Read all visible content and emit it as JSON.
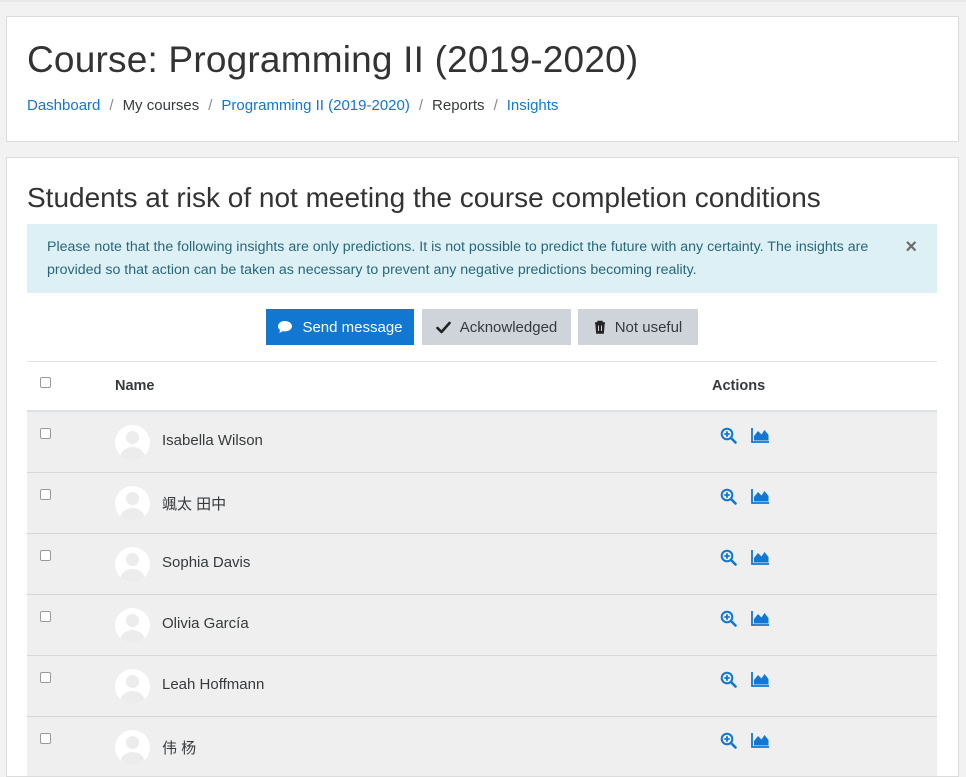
{
  "header": {
    "title": "Course: Programming II (2019-2020)",
    "breadcrumb": [
      {
        "label": "Dashboard",
        "link": true
      },
      {
        "label": "My courses",
        "link": false
      },
      {
        "label": "Programming II (2019-2020)",
        "link": true
      },
      {
        "label": "Reports",
        "link": false
      },
      {
        "label": "Insights",
        "link": true
      }
    ]
  },
  "main": {
    "title": "Students at risk of not meeting the course completion conditions",
    "alert": {
      "text": "Please note that the following insights are only predictions. It is not possible to predict the future with any certainty. The insights are provided so that action can be taken as necessary to prevent any negative predictions becoming reality.",
      "close_icon": "×"
    },
    "buttons": {
      "send_message": "Send message",
      "acknowledged": "Acknowledged",
      "not_useful": "Not useful"
    },
    "table": {
      "columns": {
        "name": "Name",
        "actions": "Actions"
      },
      "rows": [
        {
          "name": "Isabella Wilson"
        },
        {
          "name": "颯太 田中"
        },
        {
          "name": "Sophia Davis"
        },
        {
          "name": "Olivia García"
        },
        {
          "name": "Leah Hoffmann"
        },
        {
          "name": "伟 杨"
        }
      ]
    }
  },
  "colors": {
    "primary": "#1177d1",
    "alert_bg": "#dcf0f5",
    "alert_text": "#2a6778",
    "secondary_btn": "#ced4da",
    "row_bg": "#efefef"
  },
  "icons": {
    "send_message": "comment-icon",
    "acknowledged": "check-icon",
    "not_useful": "trash-icon",
    "row_action_1": "zoom-in-icon",
    "row_action_2": "area-chart-icon",
    "avatar": "user-avatar-icon"
  }
}
